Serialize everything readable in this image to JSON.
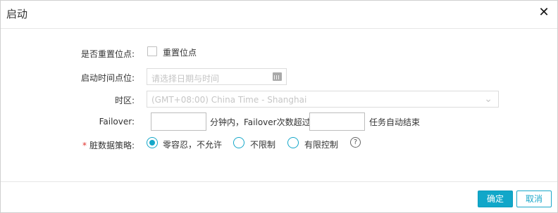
{
  "dialog": {
    "title": "启动",
    "close_icon": "close-icon"
  },
  "form": {
    "reset_point": {
      "label": "是否重置位点:",
      "checkbox_label": "重置位点"
    },
    "start_time": {
      "label": "启动时间点位:",
      "placeholder": "请选择日期与时间"
    },
    "timezone": {
      "label": "时区:",
      "value": "(GMT+08:00) China Time - Shanghai"
    },
    "failover": {
      "label": "Failover:",
      "text_middle": "分钟内，Failover次数超过",
      "text_end": "任务自动结束",
      "minutes_value": "",
      "count_value": ""
    },
    "dirty_data": {
      "label": "脏数据策略:",
      "required_mark": "*",
      "options": [
        "零容忍，不允许",
        "不限制",
        "有限控制"
      ],
      "selected": 0,
      "help_icon": "help-icon"
    }
  },
  "footer": {
    "ok_label": "确定",
    "cancel_label": "取消"
  },
  "colors": {
    "accent": "#11a7c9",
    "required": "#e0322e",
    "border": "#dcdcdc"
  }
}
